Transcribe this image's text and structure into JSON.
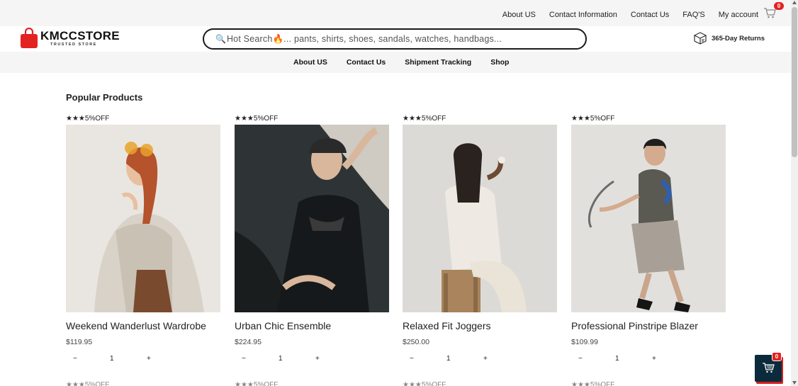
{
  "topbar": {
    "links": [
      "About US",
      "Contact Information",
      "Contact Us",
      "FAQ'S",
      "My account"
    ],
    "cart_count": "0"
  },
  "header": {
    "logo_name": "KMCCSTORE",
    "logo_tagline": "TRUSTED STORE",
    "search_placeholder": "Hot Search🔥... pants, shirts, shoes, sandals, watches, handbags...",
    "returns_label": "365-Day Returns"
  },
  "nav": {
    "items": [
      "About US",
      "Contact Us",
      "Shipment Tracking",
      "Shop"
    ]
  },
  "section": {
    "title": "Popular Products"
  },
  "products": [
    {
      "badge": "★★★5%OFF",
      "name": "Weekend Wanderlust Wardrobe",
      "price": "$119.95",
      "qty": "1"
    },
    {
      "badge": "★★★5%OFF",
      "name": "Urban Chic Ensemble",
      "price": "$224.95",
      "qty": "1"
    },
    {
      "badge": "★★★5%OFF",
      "name": "Relaxed Fit Joggers",
      "price": "$250.00",
      "qty": "1"
    },
    {
      "badge": "★★★5%OFF",
      "name": "Professional Pinstripe Blazer",
      "price": "$109.99",
      "qty": "1"
    }
  ],
  "qty_controls": {
    "minus": "−",
    "plus": "+"
  },
  "floating_cart": {
    "count": "0"
  },
  "colors": {
    "accent": "#e32222",
    "cart_bg": "#0b2a3c",
    "bar_bg": "#f5f5f5"
  },
  "icons": {
    "search": "search-icon",
    "cart": "cart-icon",
    "returns": "returns-box-icon",
    "logo": "shopping-bag-icon"
  }
}
